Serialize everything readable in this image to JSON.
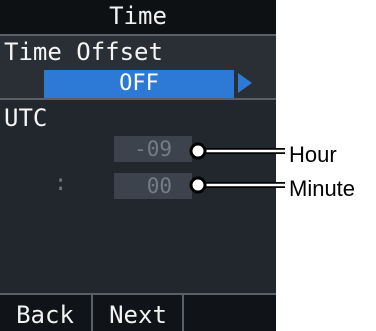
{
  "screen": {
    "title": "Time",
    "time_offset": {
      "label": "Time Offset",
      "value": "OFF"
    },
    "utc": {
      "label": "UTC",
      "hour_value": "-09",
      "separator": ":",
      "minute_value": "00"
    },
    "softkeys": {
      "back": "Back",
      "next": "Next"
    }
  },
  "callouts": {
    "hour": "Hour",
    "minute": "Minute"
  }
}
